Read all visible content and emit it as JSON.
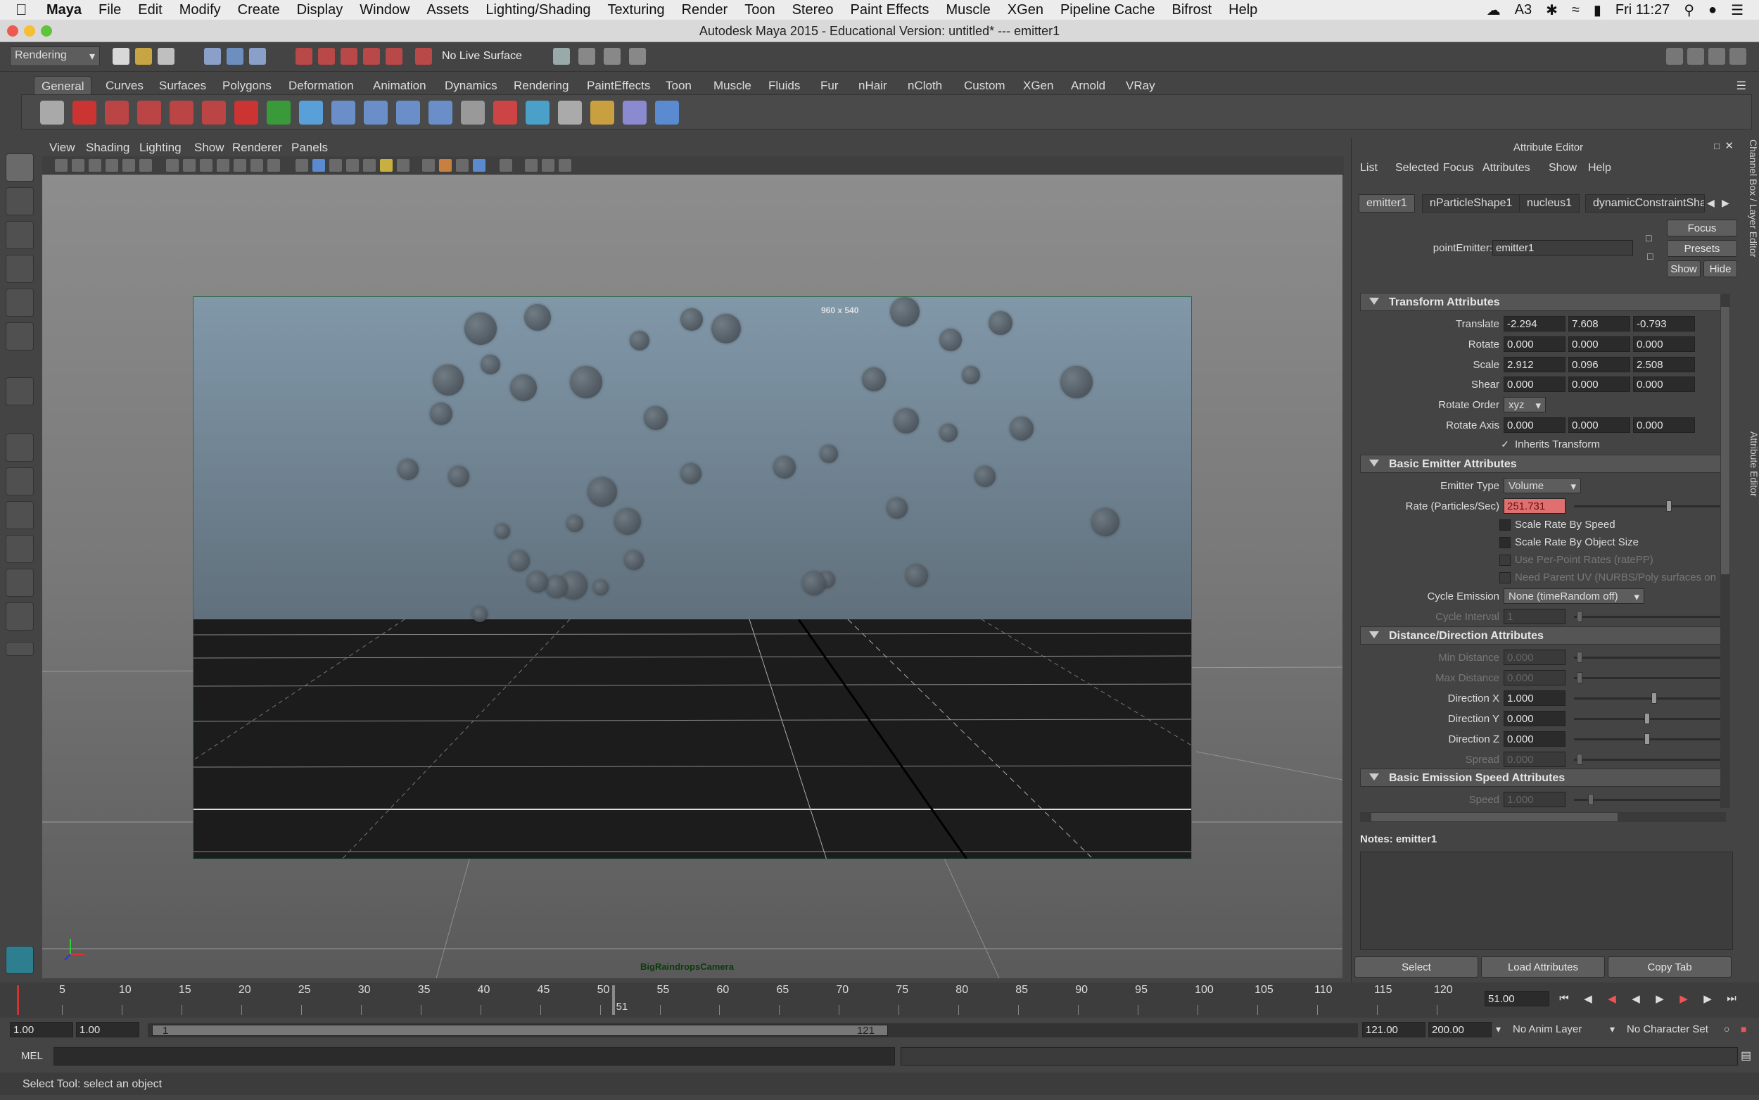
{
  "mac_menubar": {
    "app": "Maya",
    "items": [
      "File",
      "Edit",
      "Modify",
      "Create",
      "Display",
      "Window",
      "Assets",
      "Lighting/Shading",
      "Texturing",
      "Render",
      "Toon",
      "Stereo",
      "Paint Effects",
      "Muscle",
      "XGen",
      "Pipeline Cache",
      "Bifrost",
      "Help"
    ],
    "clock": "Fri 11:27",
    "badge_count": "3"
  },
  "window_title": "Autodesk Maya 2015 - Educational Version: untitled*   ---   emitter1",
  "status_line": {
    "menu_set": "Rendering",
    "live_surface": "No Live Surface"
  },
  "shelf": {
    "tabs": [
      "General",
      "Curves",
      "Surfaces",
      "Polygons",
      "Deformation",
      "Animation",
      "Dynamics",
      "Rendering",
      "PaintEffects",
      "Toon",
      "Muscle",
      "Fluids",
      "Fur",
      "nHair",
      "nCloth",
      "Custom",
      "XGen",
      "Arnold",
      "VRay"
    ],
    "active_tab": "General"
  },
  "panel": {
    "menus": [
      "View",
      "Shading",
      "Lighting",
      "Show",
      "Renderer",
      "Panels"
    ],
    "resolution": "960 x 540",
    "camera": "BigRaindropsCamera"
  },
  "attribute_editor": {
    "title": "Attribute Editor",
    "menus": [
      "List",
      "Selected",
      "Focus",
      "Attributes",
      "Show",
      "Help"
    ],
    "tabs": [
      "emitter1",
      "nParticleShape1",
      "nucleus1",
      "dynamicConstraintSha"
    ],
    "node_type_label": "pointEmitter:",
    "node_name": "emitter1",
    "buttons": {
      "focus": "Focus",
      "presets": "Presets",
      "show": "Show",
      "hide": "Hide"
    },
    "transform": {
      "header": "Transform Attributes",
      "translate_label": "Translate",
      "translate": [
        "-2.294",
        "7.608",
        "-0.793"
      ],
      "rotate_label": "Rotate",
      "rotate": [
        "0.000",
        "0.000",
        "0.000"
      ],
      "scale_label": "Scale",
      "scale": [
        "2.912",
        "0.096",
        "2.508"
      ],
      "shear_label": "Shear",
      "shear": [
        "0.000",
        "0.000",
        "0.000"
      ],
      "rotate_order_label": "Rotate Order",
      "rotate_order": "xyz",
      "rotate_axis_label": "Rotate Axis",
      "rotate_axis": [
        "0.000",
        "0.000",
        "0.000"
      ],
      "inherits_label": "Inherits Transform"
    },
    "basic_emitter": {
      "header": "Basic Emitter Attributes",
      "emitter_type_label": "Emitter Type",
      "emitter_type": "Volume",
      "rate_label": "Rate (Particles/Sec)",
      "rate": "251.731",
      "rate_slider_pos": 0.62,
      "scale_rate_speed": "Scale Rate By Speed",
      "scale_rate_size": "Scale Rate By Object Size",
      "per_point": "Use Per-Point Rates (ratePP)",
      "parent_uv": "Need Parent UV (NURBS/Poly surfaces on",
      "cycle_emission_label": "Cycle Emission",
      "cycle_emission": "None (timeRandom off)",
      "cycle_interval_label": "Cycle Interval",
      "cycle_interval": "1"
    },
    "distance": {
      "header": "Distance/Direction Attributes",
      "min_label": "Min Distance",
      "min": "0.000",
      "max_label": "Max Distance",
      "max": "0.000",
      "dirx_label": "Direction X",
      "dirx": "1.000",
      "diry_label": "Direction Y",
      "diry": "0.000",
      "dirz_label": "Direction Z",
      "dirz": "0.000",
      "spread_label": "Spread",
      "spread": "0.000"
    },
    "emission_speed": {
      "header": "Basic Emission Speed Attributes",
      "speed_label": "Speed",
      "speed": "1.000"
    },
    "notes": "Notes:  emitter1",
    "bottom_buttons": {
      "select": "Select",
      "load": "Load Attributes",
      "copy": "Copy Tab"
    },
    "side_tabs": [
      "Channel Box / Layer Editor",
      "Attribute Editor"
    ]
  },
  "timeline": {
    "ticks": [
      "5",
      "10",
      "15",
      "20",
      "25",
      "30",
      "35",
      "40",
      "45",
      "50",
      "55",
      "60",
      "65",
      "70",
      "75",
      "80",
      "85",
      "90",
      "95",
      "100",
      "105",
      "110",
      "115",
      "120"
    ],
    "current_frame": "51",
    "current_time_field": "51.00",
    "range_start": "1.00",
    "playback_start": "1.00",
    "range_slider_start": "1",
    "range_slider_end": "121",
    "playback_end": "121.00",
    "range_end": "200.00",
    "anim_layer": "No Anim Layer",
    "character_set": "No Character Set"
  },
  "command_line": {
    "label": "MEL"
  },
  "help_line": "Select Tool: select an object",
  "colors": {
    "accent_tab": "#5b5b5b",
    "rate_field": "#e07070",
    "current_frame": "#d83030"
  }
}
